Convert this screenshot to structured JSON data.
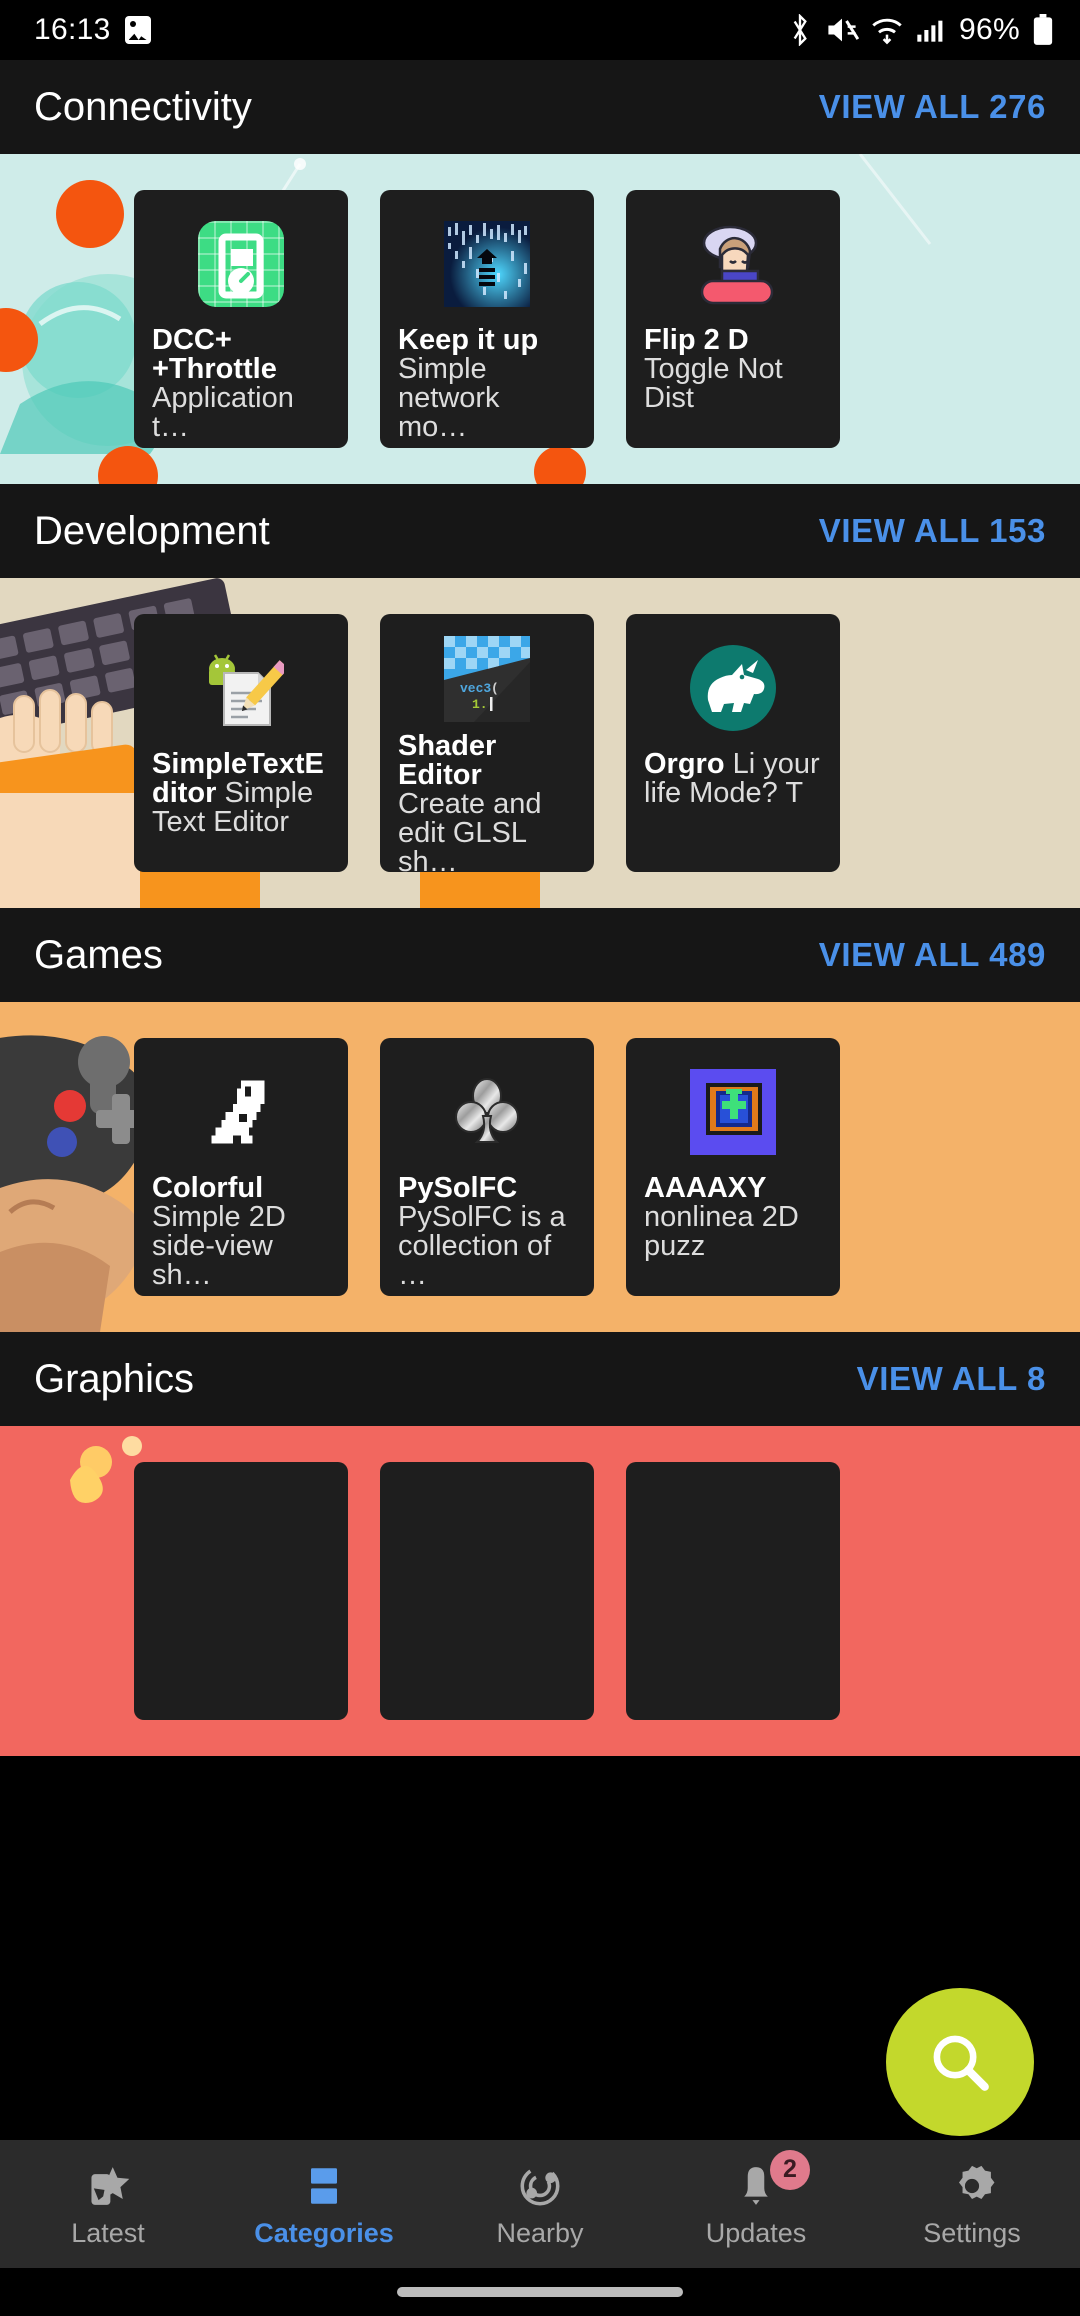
{
  "status_bar": {
    "time": "16:13",
    "battery_percent": "96%",
    "icons": [
      "gallery-icon",
      "bluetooth-icon",
      "mute-icon",
      "wifi-icon",
      "cellular-signal-icon",
      "battery-icon"
    ]
  },
  "sections": [
    {
      "title": "Connectivity",
      "view_all": "VIEW ALL 276",
      "art": "globe-with-orange-dots-illustration",
      "bg": "#cfece9",
      "apps": [
        {
          "name": "DCC+ +Throttle",
          "summary": "Application t…",
          "icon": "dcc-throttle-icon"
        },
        {
          "name": "Keep it up",
          "summary": "Simple network mo…",
          "icon": "keep-it-up-icon"
        },
        {
          "name": "Flip 2 D",
          "summary": "Toggle Not Dist",
          "icon": "flip-2-dnd-icon"
        }
      ]
    },
    {
      "title": "Development",
      "view_all": "VIEW ALL 153",
      "art": "hands-typing-on-keyboard-illustration",
      "bg": "#e2d8c0",
      "apps": [
        {
          "name": "SimpleTextEditor",
          "summary": "Simple Text Editor",
          "icon": "simple-text-editor-icon"
        },
        {
          "name": "Shader Editor",
          "summary": "Create and edit GLSL sh…",
          "icon": "shader-editor-icon"
        },
        {
          "name": "Orgro",
          "summary": "Li your life Mode? T",
          "icon": "orgro-unicorn-icon"
        }
      ]
    },
    {
      "title": "Games",
      "view_all": "VIEW ALL 489",
      "art": "hand-holding-game-controller-illustration",
      "bg": "#f4b269",
      "apps": [
        {
          "name": "Colorful",
          "summary": "Simple 2D side-view sh…",
          "icon": "colorful-dinosaur-icon"
        },
        {
          "name": "PySolFC",
          "summary": "PySolFC is a collection of …",
          "icon": "pysolfc-club-icon"
        },
        {
          "name": "AAAAXY",
          "summary": "nonlinea 2D puzz",
          "icon": "aaaaxy-icon"
        }
      ]
    },
    {
      "title": "Graphics",
      "view_all": "VIEW ALL 8",
      "art": "red-graphics-illustration",
      "bg": "#f2675f",
      "apps": []
    }
  ],
  "fab": {
    "icon": "search-icon",
    "color": "#c3d82c"
  },
  "bottom_nav": {
    "items": [
      {
        "label": "Latest",
        "icon": "star-phone-icon",
        "active": false,
        "badge": ""
      },
      {
        "label": "Categories",
        "icon": "categories-icon",
        "active": true,
        "badge": ""
      },
      {
        "label": "Nearby",
        "icon": "nearby-swirl-icon",
        "active": false,
        "badge": ""
      },
      {
        "label": "Updates",
        "icon": "bell-icon",
        "active": false,
        "badge": "2"
      },
      {
        "label": "Settings",
        "icon": "gear-icon",
        "active": false,
        "badge": ""
      }
    ],
    "active_color": "#4a90e8",
    "inactive_color": "#a8a8a8"
  }
}
